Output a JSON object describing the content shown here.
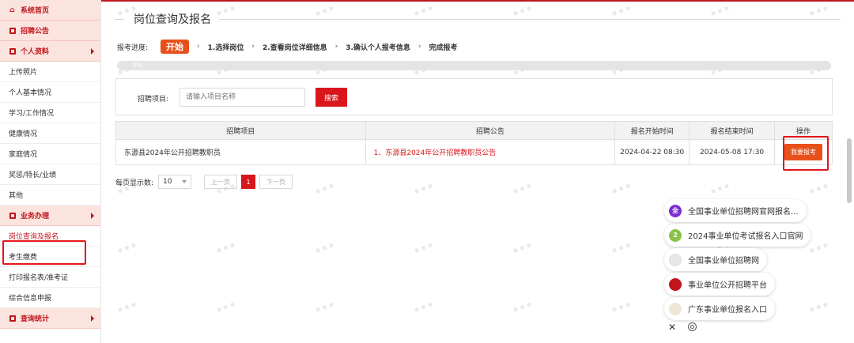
{
  "sidebar": {
    "home": "系统首页",
    "announce": "招聘公告",
    "profile_header": "个人资料",
    "profile_items": [
      "上传照片",
      "个人基本情况",
      "学习/工作情况",
      "健康情况",
      "家庭情况",
      "奖惩/特长/业绩",
      "其他"
    ],
    "business_header": "业务办理",
    "business_items": [
      "岗位查询及报名",
      "考生缴费",
      "打印报名表/准考证",
      "综合信息申报"
    ],
    "stats_header": "查询统计"
  },
  "page": {
    "title": "岗位查询及报名"
  },
  "steps": {
    "label": "报考进度:",
    "start": "开始",
    "items": [
      "1.选择岗位",
      "2.查看岗位详细信息",
      "3.确认个人报考信息",
      "完成报考"
    ],
    "separator": "›"
  },
  "progress": {
    "label": "0%",
    "value": 0
  },
  "search": {
    "label": "招聘项目:",
    "placeholder": "请输入项目名称",
    "button": "搜索"
  },
  "table": {
    "headers": [
      "招聘项目",
      "招聘公告",
      "报名开始时间",
      "报名结束时间",
      "操作"
    ],
    "rows": [
      {
        "project": "东源县2024年公开招聘教职员",
        "announcement": "1、东源县2024年公开招聘教职员公告",
        "start": "2024-04-22 08:30",
        "end": "2024-05-08 17:30",
        "action": "我要报考"
      }
    ]
  },
  "pager": {
    "page_size_label": "每页显示数:",
    "page_size": "10",
    "prev": "上一页",
    "current": "1",
    "next": "下一页"
  },
  "suggestions": [
    {
      "text": "全国事业单位招聘网官网报名...",
      "icon": "全",
      "color": "#7b2fd1"
    },
    {
      "text": "2024事业单位考试报名入口官网",
      "icon": "2",
      "color": "#8bc34a"
    },
    {
      "text": "全国事业单位招聘网",
      "icon": "",
      "color": "#e8e8e8"
    },
    {
      "text": "事业单位公开招聘平台",
      "icon": "",
      "color": "#c0151b"
    },
    {
      "text": "广东事业单位报名入口",
      "icon": "",
      "color": "#eee6d8"
    }
  ],
  "colors": {
    "brand_red": "#c0151b",
    "button_red": "#d9161b",
    "accent_orange": "#e8501a"
  }
}
